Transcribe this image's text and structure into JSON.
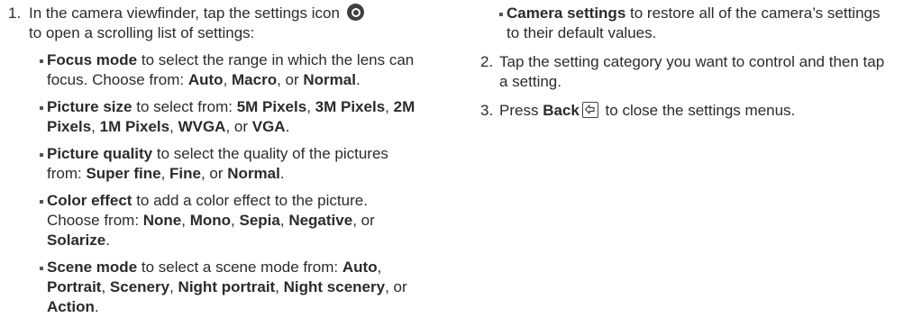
{
  "step1": {
    "number": "1.",
    "text_a": "In the camera viewfinder, tap the settings icon",
    "text_b": "to open a scrolling list of settings:",
    "icon": "settings-icon"
  },
  "items": [
    {
      "name": "Focus mode",
      "t1": " to select the range in which the lens can focus. Choose from: ",
      "o1": "Auto",
      "s1": ", ",
      "o2": "Macro",
      "s2": ", or ",
      "o3": "Normal",
      "end": "."
    },
    {
      "name": "Picture size",
      "t1": " to select from: ",
      "o1": "5M Pixels",
      "s1": ", ",
      "o2": "3M Pixels",
      "s2": ", ",
      "o3": "2M Pixels",
      "s3": ", ",
      "o4": "1M Pixels",
      "s4": ", ",
      "o5": "WVGA",
      "s5": ", or ",
      "o6": "VGA",
      "end": "."
    },
    {
      "name": "Picture quality",
      "t1": " to select the quality of the pictures from: ",
      "o1": "Super fine",
      "s1": ", ",
      "o2": "Fine",
      "s2": ", or ",
      "o3": "Normal",
      "end": "."
    },
    {
      "name": "Color effect",
      "t1": " to add a color effect to the picture. Choose from: ",
      "o1": "None",
      "s1": ", ",
      "o2": "Mono",
      "s2": ", ",
      "o3": "Sepia",
      "s3": ", ",
      "o4": "Negative",
      "s4": ", or ",
      "o5": "Solarize",
      "end": "."
    },
    {
      "name": "Scene mode",
      "t1": " to select a scene mode from: ",
      "o1": "Auto",
      "s1": ", ",
      "o2": "Portrait",
      "s2": ", ",
      "o3": "Scenery",
      "s3": ", ",
      "o4": "Night portrait",
      "s4": ", ",
      "o5": "Night scenery",
      "s5": ", or ",
      "o6": "Action",
      "end": "."
    },
    {
      "name": "Camera settings",
      "t1": " to restore all of the camera’s settings to their default values."
    }
  ],
  "step2": {
    "number": "2.",
    "text": "Tap the setting category you want to control and then tap a setting."
  },
  "step3": {
    "number": "3.",
    "pre": "Press ",
    "bold": "Back",
    "post": " to close the settings menus.",
    "icon": "back-icon"
  }
}
